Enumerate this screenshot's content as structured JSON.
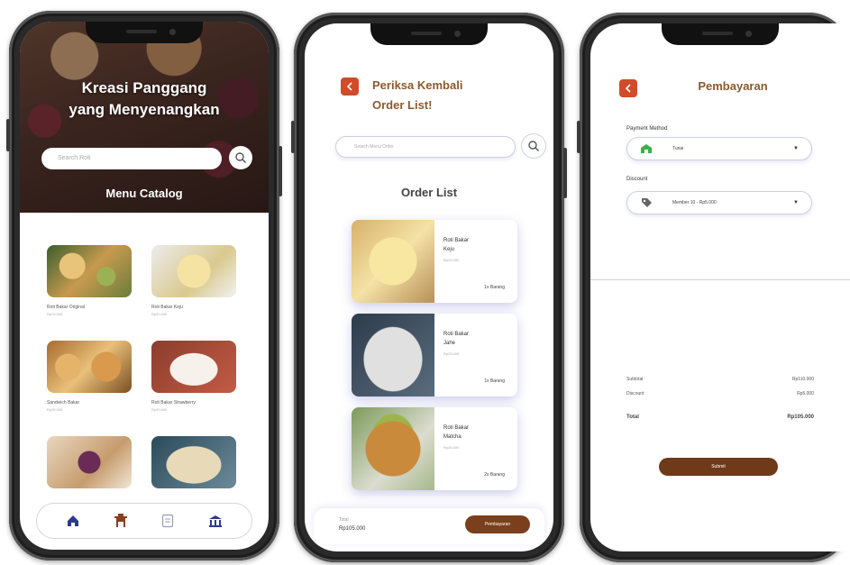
{
  "colors": {
    "accent": "#d24c2a",
    "brand_brown": "#7a3f1c",
    "title_brown": "#8a5a2f",
    "shadow_blue": "#6e6ec8"
  },
  "catalog": {
    "hero_title_line1": "Kreasi Panggang",
    "hero_title_line2": "yang Menyenangkan",
    "search_placeholder": "Search Roti",
    "section_title": "Menu Catalog",
    "items": [
      {
        "name": "Roti Bakar Original",
        "price": "Rp15.000"
      },
      {
        "name": "Roti Bakar Keju",
        "price": "Rp20.000"
      },
      {
        "name": "Sandwich Bakar",
        "price": "Rp25.000"
      },
      {
        "name": "Roti Bakar Strawberry",
        "price": "Rp20.000"
      },
      {
        "name": "",
        "price": ""
      },
      {
        "name": "",
        "price": ""
      }
    ],
    "nav": [
      "home-icon",
      "bakery-icon",
      "receipt-icon",
      "profile-icon"
    ]
  },
  "order": {
    "title_line1": "Periksa Kembali",
    "title_line2": "Order List!",
    "search_placeholder": "Search Menu Order",
    "section_title": "Order List",
    "items": [
      {
        "name_line1": "Roti Bakar",
        "name_line2": "Keju",
        "price": "Rp20.000",
        "qty": "1x Barang"
      },
      {
        "name_line1": "Roti Bakar",
        "name_line2": "Jahe",
        "price": "Rp25.000",
        "qty": "1x Barang"
      },
      {
        "name_line1": "Roti Bakar",
        "name_line2": "Matcha",
        "price": "Rp30.000",
        "qty": "2x Barang"
      }
    ],
    "total_label": "Total",
    "total_value": "Rp105.000",
    "pay_button": "Pembayaran"
  },
  "payment": {
    "title": "Pembayaran",
    "method_label": "Payment Method",
    "method_value": "Tunai",
    "discount_label": "Discount",
    "discount_value": "Member 10 - Rp5.000",
    "subtotal_label": "Subtotal",
    "subtotal_value": "Rp110.000",
    "discount_row_label": "Discount",
    "discount_row_value": "Rp5.000",
    "total_label": "Total",
    "total_value": "Rp105.000",
    "submit_button": "Submit"
  }
}
